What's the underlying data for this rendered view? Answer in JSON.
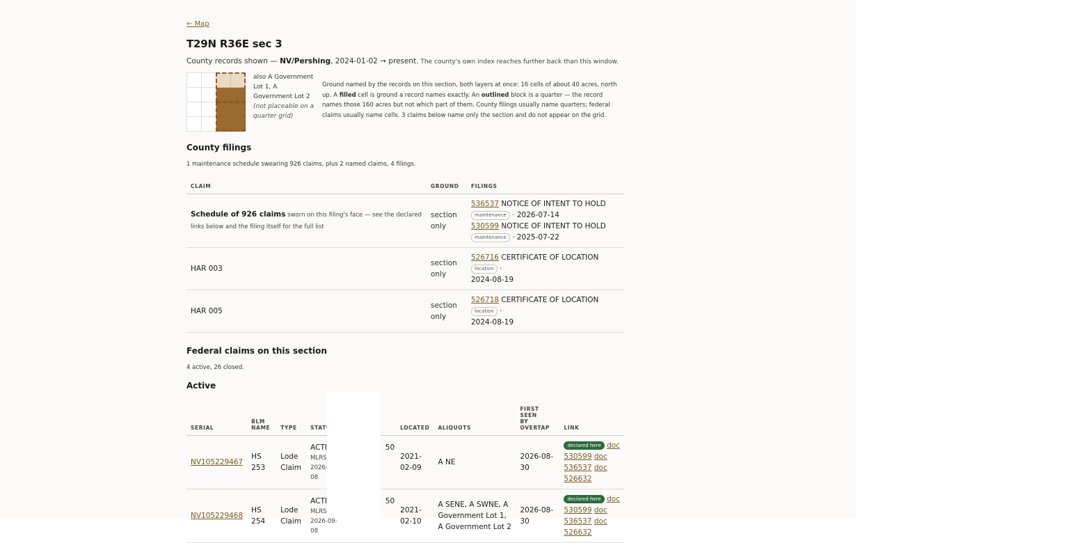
{
  "nav": {
    "back_label": "← Map"
  },
  "title": "T29N R36E sec 3",
  "window_note": {
    "prefix": "County records shown — ",
    "county": "NV/Pershing",
    "range": ", 2024-01-02 → present.",
    "small": " The county's own index reaches further back than this window."
  },
  "grid": {
    "side_prefix": "also A Government Lot 1, A Government Lot 2 ",
    "side_italic": "(not placeable on a quarter grid)",
    "legend_1": "Ground named by the records on this section, both layers at once: 16 cells of about 40 acres, north up. A ",
    "legend_filled": "filled",
    "legend_2": " cell is ground a record names exactly. An ",
    "legend_outlined": "outlined",
    "legend_3": " block is a quarter — the record names those 160 acres but not which part of them. County filings usually name quarters; federal claims usually name cells. 3 claims below name only the section and do not appear on the grid."
  },
  "county": {
    "heading": "County filings",
    "note": "1 maintenance schedule swearing 926 claims, plus 2 named claims, 4 filings.",
    "columns": [
      "Claim",
      "Ground",
      "Filings"
    ],
    "schedule": {
      "title": "Schedule of 926 claims",
      "note": " sworn on this filing's face — see the declared links below and the filing itself for the full list",
      "ground_1": "section",
      "ground_2": "only",
      "f1_num": "536537",
      "f1_type": " NOTICE OF INTENT TO HOLD",
      "f1_badge": "maintenance",
      "f1_date": " · 2026-07-14",
      "f2_num": "530599",
      "f2_type": " NOTICE OF INTENT TO HOLD",
      "f2_badge": "maintenance",
      "f2_date": " · 2025-07-22"
    },
    "rows": [
      {
        "claim": "HAR 003",
        "ground_1": "section",
        "ground_2": "only",
        "num": "526716",
        "type": " CERTIFICATE OF LOCATION ",
        "badge": "location",
        "dot": " ·",
        "date": "2024-08-19"
      },
      {
        "claim": "HAR 005",
        "ground_1": "section",
        "ground_2": "only",
        "num": "526718",
        "type": " CERTIFICATE OF LOCATION ",
        "badge": "location",
        "dot": " ·",
        "date": "2024-08-19"
      }
    ]
  },
  "federal": {
    "heading": "Federal claims on this section",
    "note": "4 active, 26 closed.",
    "active_heading": "Active",
    "columns": {
      "serial": "Serial",
      "blm_1": "BLM",
      "blm_2": "Name",
      "type": "Type",
      "status": "Status",
      "located": "Located",
      "aliquots": "Aliquots",
      "first_1": "First",
      "first_2": "seen",
      "first_3": "by",
      "first_4": "Overtap",
      "link": "Link"
    },
    "rows": [
      {
        "serial": "NV105229467",
        "name_1": "HS",
        "name_2": "253",
        "type_1": "Lode",
        "type_2": "Claim",
        "status": "ACTIVE",
        "status_sub_1": "MLRS,",
        "status_sub_2": "2026-09-",
        "status_sub_3": "08",
        "hidden_fragment": "50",
        "located_1": "2021-",
        "located_2": "02-09",
        "aliquots": "A NE",
        "first_1": "2026-08-",
        "first_2": "30",
        "badge": "declared here",
        "l0": "doc",
        "l1a": "530599",
        "l1b": "doc",
        "l2a": "536537",
        "l2b": "doc",
        "l3": "526632"
      },
      {
        "serial": "NV105229468",
        "name_1": "HS",
        "name_2": "254",
        "type_1": "Lode",
        "type_2": "Claim",
        "status": "ACTIVE",
        "status_sub_1": "MLRS,",
        "status_sub_2": "2026-09-",
        "status_sub_3": "08",
        "hidden_fragment": "50",
        "located_1": "2021-",
        "located_2": "02-10",
        "aliquots": "A SENE, A SWNE, A Government Lot 1, A Government Lot 2",
        "first_1": "2026-08-",
        "first_2": "30",
        "badge": "declared here",
        "l0": "doc",
        "l1a": "530599",
        "l1b": "doc",
        "l2a": "536537",
        "l2b": "doc",
        "l3": "526632"
      }
    ]
  }
}
